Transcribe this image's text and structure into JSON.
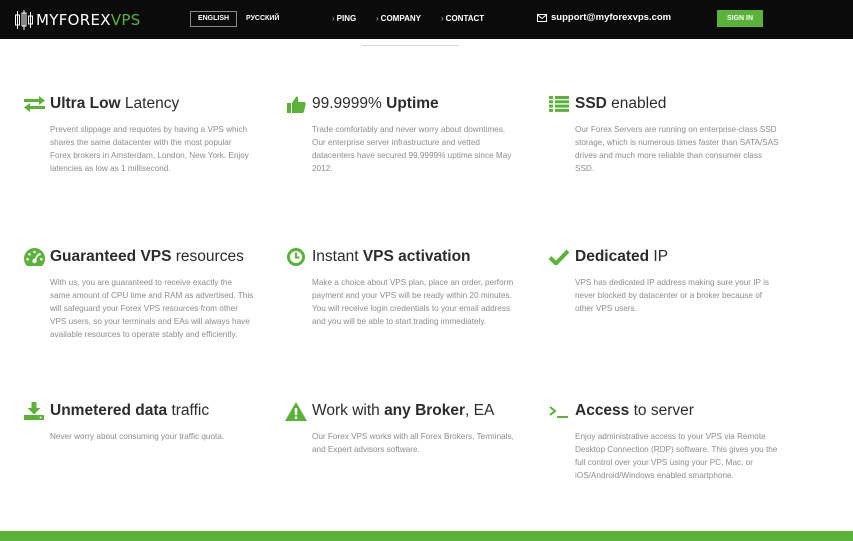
{
  "header": {
    "logo": {
      "part1": "MYFOREX",
      "part2": "VPS"
    },
    "languages": {
      "english": "ENGLISH",
      "russian": "РУССКИЙ"
    },
    "nav": [
      {
        "chevron": "›",
        "label": "PING"
      },
      {
        "chevron": "›",
        "label": "COMPANY"
      },
      {
        "chevron": "›",
        "label": "CONTACT"
      }
    ],
    "support_email": "support@myforexvps.com",
    "signin_label": "SIGN IN"
  },
  "features": [
    {
      "icon": "arrows-exchange-icon",
      "title": {
        "pre": "",
        "bold": "Ultra Low",
        "mid": " Latency",
        "bold2": "",
        "post": ""
      },
      "description": "Prevent slippage and requotes by having a VPS which shares the same datacenter with the most popular Forex brokers in Amsterdam, London, New York. Enjoy latencies as low as 1 millisecond."
    },
    {
      "icon": "thumbs-up-icon",
      "title": {
        "pre": "99.9999% ",
        "bold": "Uptime",
        "mid": "",
        "bold2": "",
        "post": ""
      },
      "description": "Trade comfortably and never worry about downtimes. Our enterprise server infrastructure and vetted datacenters have secured 99.9999% uptime since May 2012."
    },
    {
      "icon": "list-icon",
      "title": {
        "pre": "",
        "bold": "SSD",
        "mid": " enabled",
        "bold2": "",
        "post": ""
      },
      "description": "Our Forex Servers are running on enterprise-class SSD storage, which is numerous times faster than SATA/SAS drives and much more reliable than consumer class SSD."
    },
    {
      "icon": "dashboard-gauge-icon",
      "title": {
        "pre": "",
        "bold": "Guaranteed",
        "mid": " ",
        "bold2": "VPS",
        "post": " resources"
      },
      "description": "With us, you are guaranteed to receive exactly the same amount of CPU time and RAM as advertised. This will safeguard your Forex VPS resources from other VPS users, so your terminals and EAs will always have available resources to operate stably and efficiently."
    },
    {
      "icon": "clock-icon",
      "title": {
        "pre": "Instant ",
        "bold": "VPS activation",
        "mid": "",
        "bold2": "",
        "post": ""
      },
      "description": "Make a choice about VPS plan, place an order, perform payment and your VPS will be ready within 20 minutes. You will receive login credentials to your email address and you will be able to start trading immediately."
    },
    {
      "icon": "checkmark-icon",
      "title": {
        "pre": "",
        "bold": "Dedicated",
        "mid": " IP",
        "bold2": "",
        "post": ""
      },
      "description": "VPS has dedicated IP address making sure your IP is never blocked by datacenter or a broker because of other VPS users."
    },
    {
      "icon": "download-icon",
      "title": {
        "pre": "",
        "bold": "Unmetered data",
        "mid": " traffic",
        "bold2": "",
        "post": ""
      },
      "description": "Never worry about consuming your traffic quota."
    },
    {
      "icon": "warning-icon",
      "title": {
        "pre": "Work with ",
        "bold": "any Broker",
        "mid": ", EA",
        "bold2": "",
        "post": ""
      },
      "description": "Our Forex VPS works with all Forex Brokers, Terminals, and Expert advisors software."
    },
    {
      "icon": "terminal-icon",
      "title": {
        "pre": "",
        "bold": "Access",
        "mid": " to server",
        "bold2": "",
        "post": ""
      },
      "description": "Enjoy administrative access to your VPS via Remote Desktop Connection (RDP) software. This gives you the full control over your VPS using your PC, Mac, or iOS/Android/Windows enabled smartphone."
    }
  ],
  "colors": {
    "brand_green": "#5ab239",
    "topbar": "#0b0b0b",
    "text_dark": "#2c2c2c",
    "text_muted": "#8d8d8d"
  }
}
